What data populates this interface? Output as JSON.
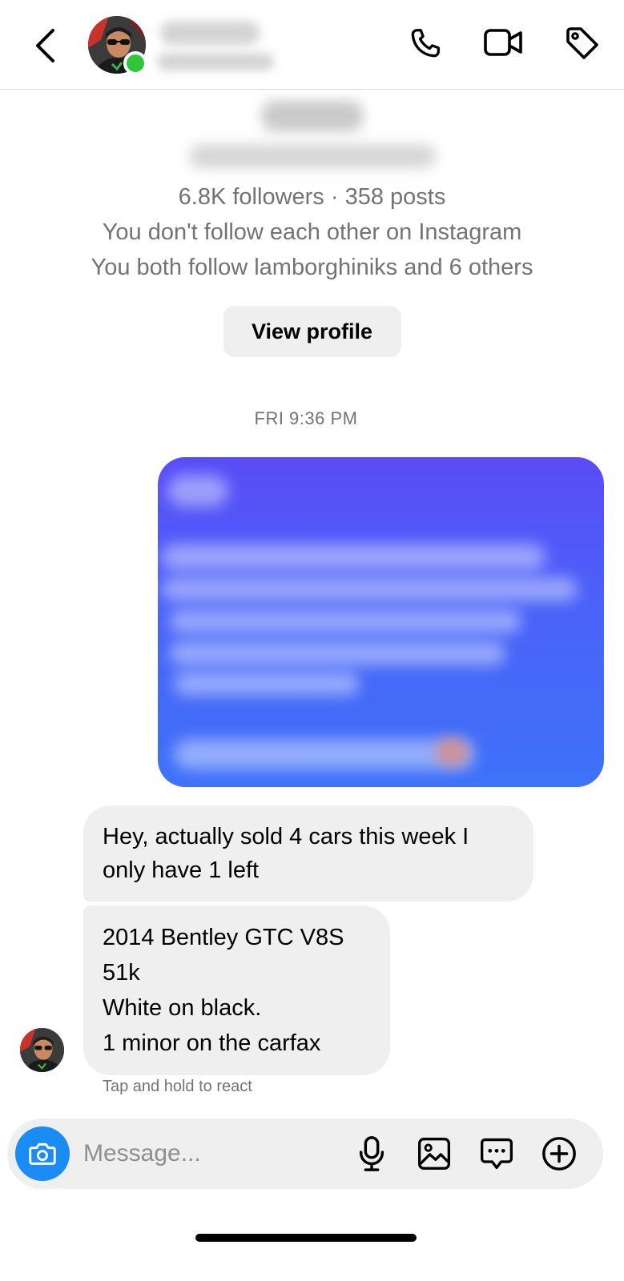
{
  "header": {
    "icons": [
      "back-icon",
      "phone-icon",
      "video-camera-icon",
      "tag-icon"
    ],
    "online_color": "#31c73b"
  },
  "profile": {
    "stats": "6.8K followers · 358 posts",
    "follow_status": "You don't follow each other on Instagram",
    "mutuals": "You both follow lamborghiniks and 6 others",
    "view_profile_label": "View profile"
  },
  "thread": {
    "timestamp": "FRI 9:36 PM",
    "sent_bubble_colors": [
      "#5a4cf7",
      "#3e72f9"
    ],
    "received": [
      {
        "text": "Hey, actually sold 4 cars this week I only have 1 left"
      },
      {
        "lines": [
          "2014 Bentley GTC V8S",
          "51k",
          "White on black.",
          "1 minor on the carfax"
        ]
      }
    ],
    "react_hint": "Tap and hold to react"
  },
  "composer": {
    "placeholder": "Message...",
    "accent": "#1a8cf5",
    "icons": [
      "camera-icon",
      "microphone-icon",
      "gallery-icon",
      "sticker-icon",
      "plus-icon"
    ]
  }
}
